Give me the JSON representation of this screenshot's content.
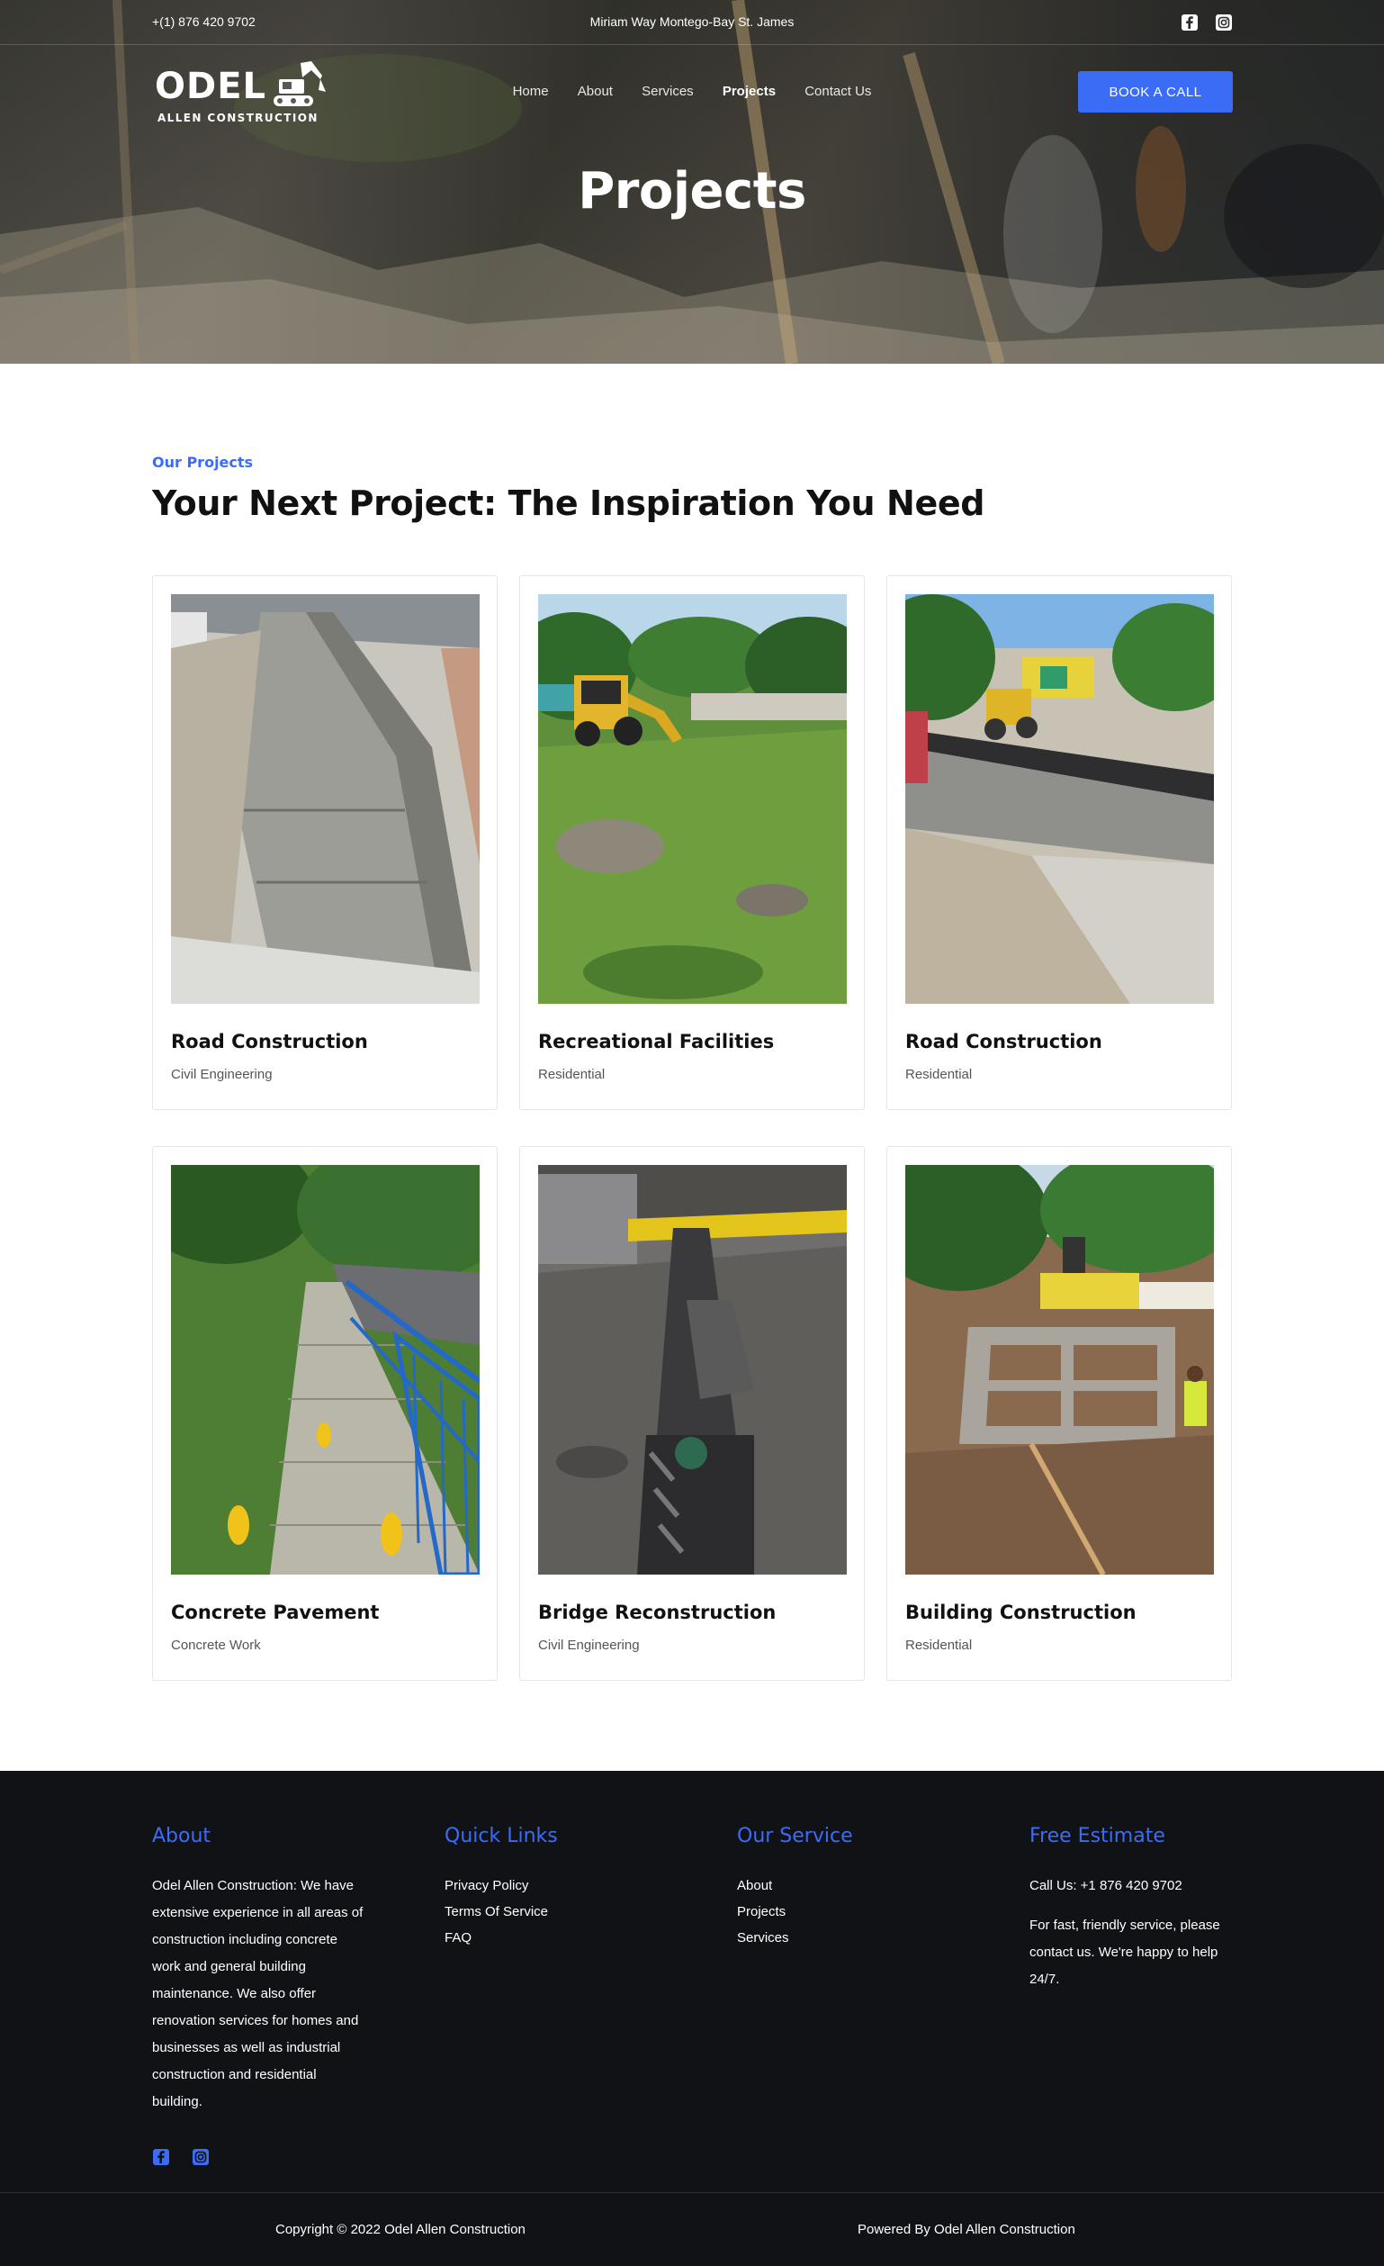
{
  "topbar": {
    "phone": "+(1) 876 420 9702",
    "address": "Miriam Way Montego-Bay St. James",
    "socials": [
      "facebook-icon",
      "instagram-icon"
    ]
  },
  "logo": {
    "word": "ODEL",
    "sub": "ALLEN CONSTRUCTION"
  },
  "nav": {
    "items": [
      {
        "label": "Home"
      },
      {
        "label": "About"
      },
      {
        "label": "Services"
      },
      {
        "label": "Projects",
        "active": true
      },
      {
        "label": "Contact Us"
      }
    ],
    "cta": "BOOK A CALL"
  },
  "hero": {
    "title": "Projects"
  },
  "projects": {
    "eyebrow": "Our Projects",
    "title": "Your Next Project: The Inspiration You Need",
    "cards": [
      {
        "title": "Road Construction",
        "category": "Civil Engineering",
        "image": "concrete-sidewalk-curb"
      },
      {
        "title": "Recreational Facilities",
        "category": "Residential",
        "image": "backhoe-on-grass-field"
      },
      {
        "title": "Road Construction",
        "category": "Residential",
        "image": "road-roller-asphalt"
      },
      {
        "title": "Concrete Pavement",
        "category": "Concrete Work",
        "image": "sidewalk-blue-railing"
      },
      {
        "title": "Bridge Reconstruction",
        "category": "Civil Engineering",
        "image": "bridge-expansion-joint"
      },
      {
        "title": "Building Construction",
        "category": "Residential",
        "image": "block-foundation-walls"
      }
    ]
  },
  "footer": {
    "about": {
      "heading": "About",
      "text": "Odel Allen Construction: We have extensive experience in all areas of construction including concrete work and general building maintenance. We also offer renovation services for homes and businesses as well as industrial construction and residential building."
    },
    "quick_links": {
      "heading": "Quick Links",
      "items": [
        "Privacy Policy",
        "Terms Of Service",
        "FAQ"
      ]
    },
    "our_service": {
      "heading": "Our Service",
      "items": [
        "About",
        "Projects",
        "Services"
      ]
    },
    "free_estimate": {
      "heading": "Free Estimate",
      "call": "Call Us: +1 876 420 9702",
      "text": "For fast, friendly service, please contact us. We're happy to help 24/7."
    },
    "copyright": "Copyright © 2022 Odel Allen Construction",
    "powered": "Powered By Odel Allen Construction"
  },
  "colors": {
    "accent": "#3b6cf6",
    "footer_bg": "#111216"
  }
}
